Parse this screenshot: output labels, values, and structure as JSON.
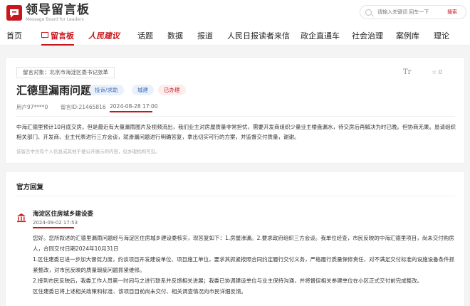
{
  "header": {
    "logo_title": "领导留言板",
    "logo_subtitle": "Message Board for Leaders",
    "search_placeholder": "请输入关键词 回车一下",
    "search_button": "搜索"
  },
  "nav": {
    "items": [
      "首页",
      "留言板",
      "人民建议",
      "话题",
      "数据",
      "报道",
      "人民日报读者来信",
      "政企直通车",
      "社会治理",
      "案例库",
      "理论"
    ],
    "active": "留言板"
  },
  "message": {
    "target": "留言对象：北京市海淀区委书记张革",
    "font_icon": "Tr",
    "star_count": "0",
    "title": "汇德里漏雨问题",
    "tags": [
      "投诉/求助",
      "城建",
      "已办理"
    ],
    "user": "用户97****0",
    "id": "留言ID:21465816",
    "date": "2024-08-28 17:00",
    "body": "中海汇德里预计10月底交房。但是最近有大量漏雨图片及视频流出，我们业主对房屋质量非常担忧，需要开发商组织少量业主楼盘漏水，待交房后再解决为时已晚。但协商无果。恳请组织相关部门、开发商、业主代表进行三方会谈，就渗漏问题进行明确答复，拿出切实可行的方案，并监督交付质量，谢谢。",
    "disclaimer": "该留言中含有个人信息或其他不便公开展示的内容，仅办理机构可见。"
  },
  "reply": {
    "section_title": "官方回复",
    "org": "海淀区住房城乡建设委",
    "date": "2024-09-02 17:53",
    "lines": [
      "您好。您所叙述的汇德里漏雨问题经与海淀区住房城乡建设委核实，现答复如下：1.房屋渗漏。2.要求政府组织三方会谈。我单位经查，市民反映的中海汇德里项目，尚未交付购房人，合同交付日期2024年10月31日",
      "1.区住建委已进一步加大督促力度，约谈项目开发建设单位、项目施工单位，要求其抓紧按照合同约定履行交付义务，严格履行质量保修责任，对不满足交付标准的设施设备条件抓紧整改，对市民反映的质量瑕疵问题抓紧维修。",
      "2.接到市民反映后，我委工作人员第一时间与之进行联系并反馈相关进展；我委已协调建设单位与业主保持沟通，并将督促相关参建单位在小区正式交付前完成整改。",
      "区住建委已将上述相关政策和标准、该项目目前尚未交付、相关调查情况向市民详细反馈。"
    ]
  },
  "colors": {
    "accent": "#c8161d",
    "tag_blue": "#3a6fb6"
  }
}
